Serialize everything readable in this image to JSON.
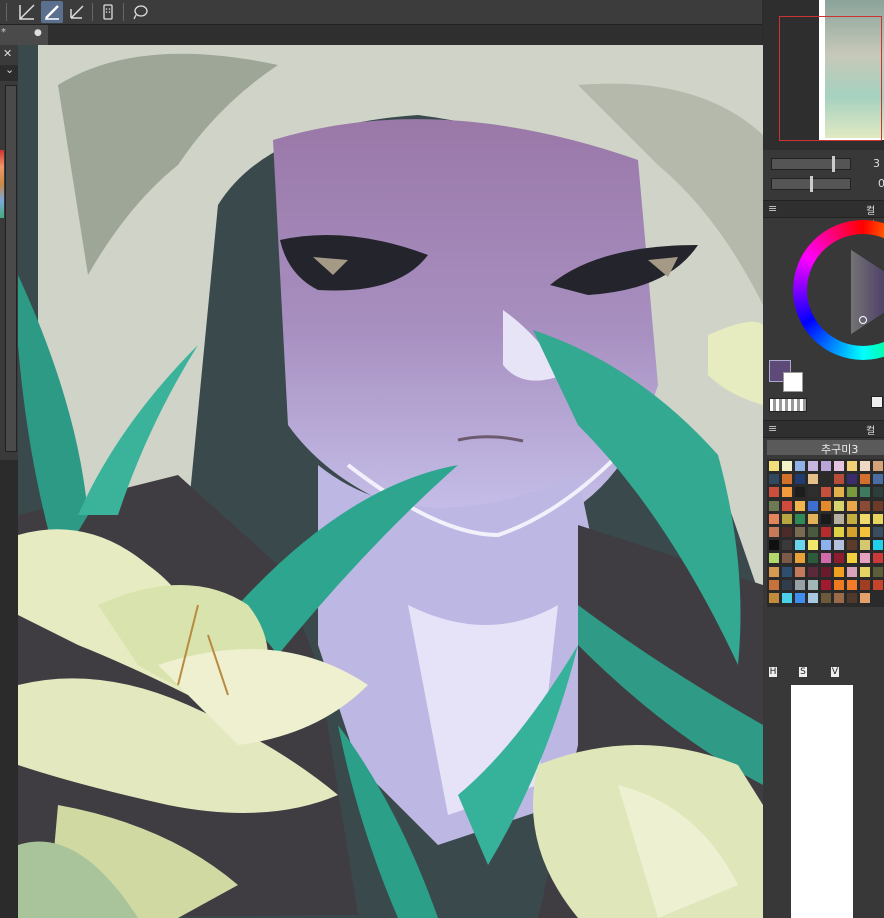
{
  "toolbar": {
    "icons": [
      "pen-line-icon",
      "brush-icon",
      "ruler-icon",
      "phone-icon",
      "lasso-icon"
    ],
    "active_index": 1
  },
  "tab": {
    "star": "*",
    "dot": "●"
  },
  "left_panel": {
    "close": "✕",
    "dropdown": "⌄"
  },
  "navigator": {
    "zoom_value": "3",
    "angle_value": "0"
  },
  "color_wheel_panel": {
    "title": "컬러",
    "current_color": "#5e4a78",
    "sub_color": "#ffffff"
  },
  "color_set_panel": {
    "title": "컬러",
    "set_name": "추구미3",
    "bottom_labels": [
      "H",
      "S",
      "V"
    ]
  },
  "colors": {
    "accent": "#5b6f8f",
    "panel_bg": "#383838"
  }
}
